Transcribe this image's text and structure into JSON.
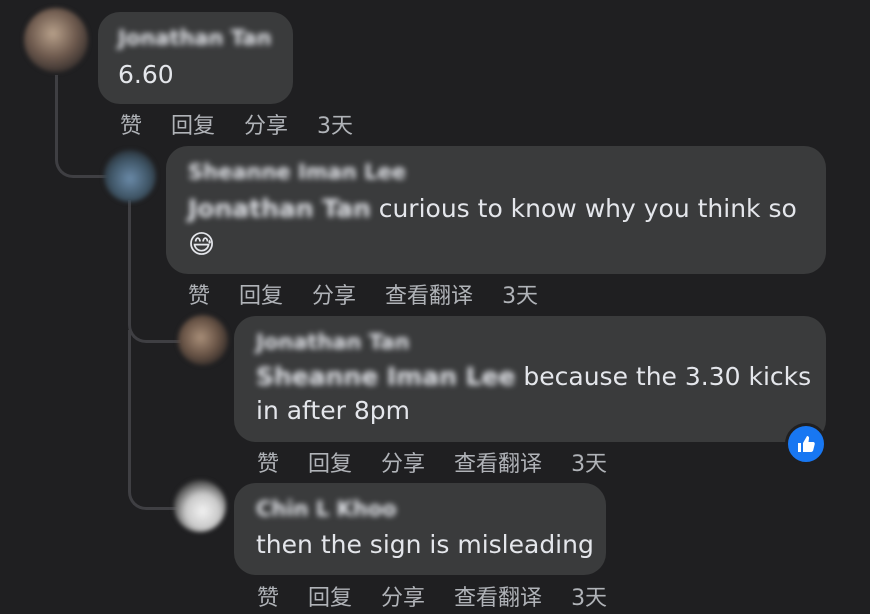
{
  "comments": [
    {
      "author": "Jonathan Tan",
      "text": "6.60",
      "actions": [
        "赞",
        "回复",
        "分享"
      ],
      "time": "3天"
    },
    {
      "author": "Sheanne Iman Lee",
      "mention": "Jonathan Tan",
      "text": " curious to know why you think so",
      "emoji": "😅",
      "actions": [
        "赞",
        "回复",
        "分享",
        "查看翻译"
      ],
      "time": "3天"
    },
    {
      "author": "Jonathan Tan",
      "mention": "Sheanne Iman Lee",
      "text_line1": " because the 3.30 kicks",
      "text_line2": "in after 8pm",
      "actions": [
        "赞",
        "回复",
        "分享",
        "查看翻译"
      ],
      "time": "3天"
    },
    {
      "author": "Chin L Khoo",
      "text": "then the sign is misleading",
      "actions": [
        "赞",
        "回复",
        "分享",
        "查看翻译"
      ],
      "time": "3天"
    }
  ],
  "reaction_icon": "thumbs-up-icon",
  "colors": {
    "background": "#1f1f21",
    "bubble": "#3a3b3c",
    "text": "#e4e6eb",
    "muted": "#b0b3b8",
    "like": "#1877f2"
  }
}
